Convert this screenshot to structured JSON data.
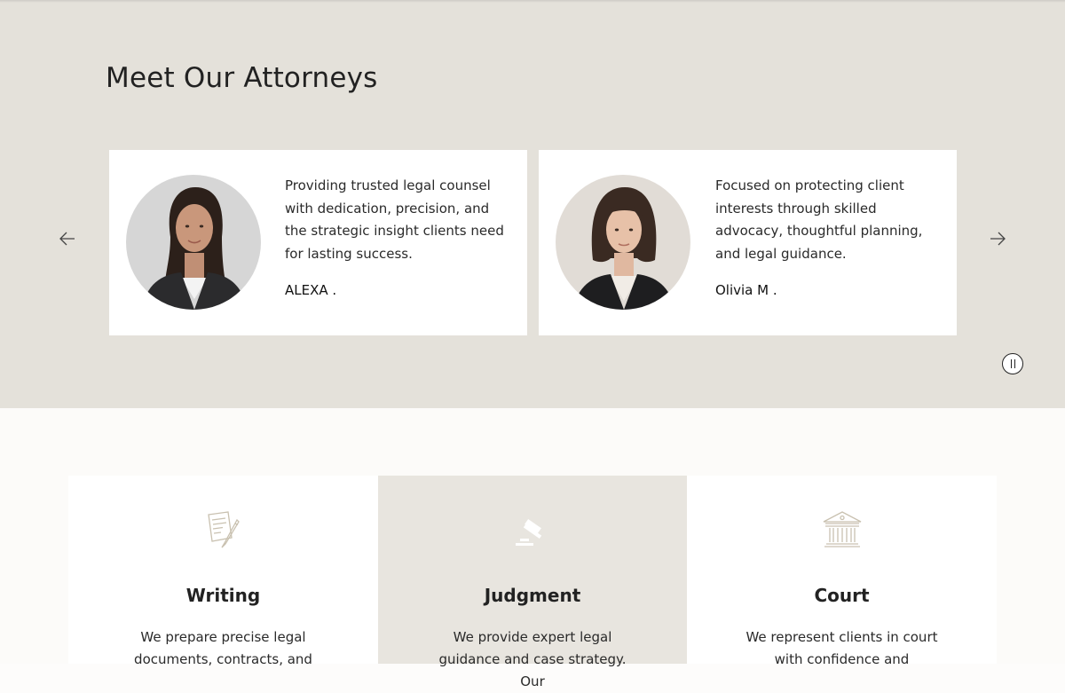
{
  "attorneys_section": {
    "title": "Meet Our Attorneys",
    "prev_icon": "arrow-left-icon",
    "next_icon": "arrow-right-icon",
    "pause_icon": "pause-icon",
    "cards": [
      {
        "quote": "Providing trusted legal counsel with dedication, precision, and the strategic insight clients need for lasting success.",
        "name": "ALEXA ."
      },
      {
        "quote": "Focused on protecting client interests through skilled advocacy, thoughtful planning, and  legal guidance.",
        "name": "Olivia M ."
      }
    ]
  },
  "services_section": {
    "items": [
      {
        "icon": "document-pen-icon",
        "title": "Writing",
        "description": "We prepare precise legal documents, contracts, and"
      },
      {
        "icon": "gavel-icon",
        "title": "Judgment",
        "description": "We provide expert legal guidance and case strategy. Our"
      },
      {
        "icon": "courthouse-icon",
        "title": "Court",
        "description": "We represent clients in court with confidence and"
      }
    ]
  },
  "colors": {
    "attorneys_background": "#e4e1da",
    "card_background": "#ffffff",
    "services_background": "#fcfbf9",
    "highlighted_service_background": "#e8e5df",
    "icon_accent": "#c9c1b0",
    "text": "#222222"
  }
}
